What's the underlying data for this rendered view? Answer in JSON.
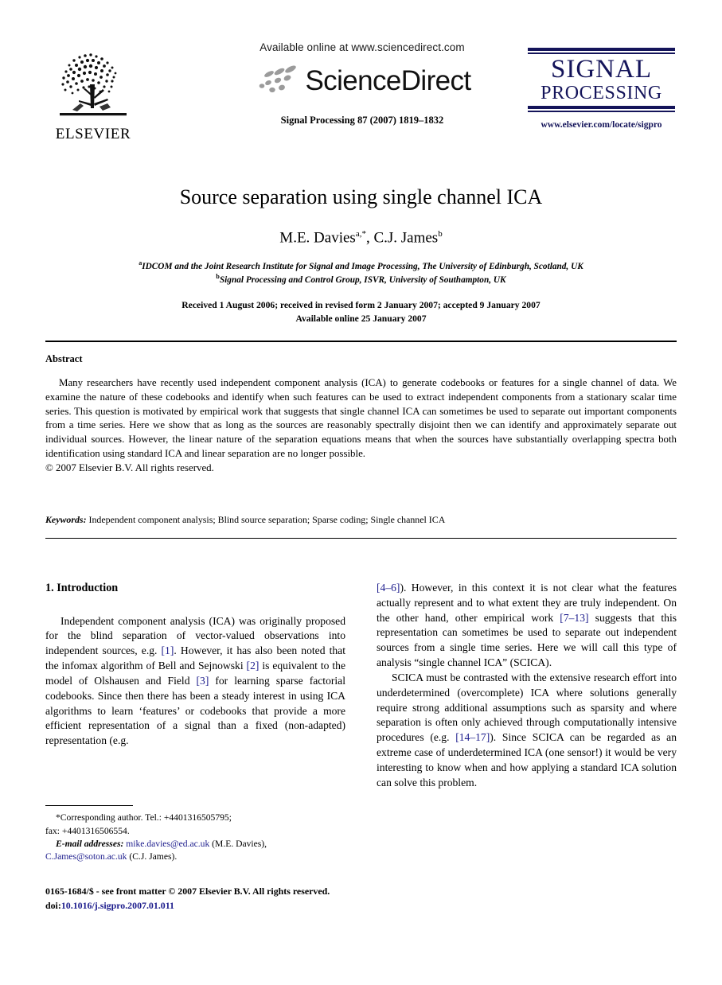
{
  "masthead": {
    "publisher_name": "ELSEVIER",
    "available_online": "Available online at www.sciencedirect.com",
    "sciencedirect_word": "ScienceDirect",
    "journal_ref": "Signal Processing 87 (2007) 1819–1832",
    "journal_logo_line1": "SIGNAL",
    "journal_logo_line2": "PROCESSING",
    "journal_url": "www.elsevier.com/locate/sigpro"
  },
  "title_block": {
    "title": "Source separation using single channel ICA",
    "authors_text": "M.E. Davies",
    "author1_sup": "a,*",
    "authors_text2": ", C.J. James",
    "author2_sup": "b",
    "affiliation_a_sup": "a",
    "affiliation_a": "IDCOM and the Joint Research Institute for Signal and Image Processing, The University of Edinburgh, Scotland, UK",
    "affiliation_b_sup": "b",
    "affiliation_b": "Signal Processing and Control Group, ISVR, University of Southampton, UK",
    "received": "Received 1 August 2006; received in revised form 2 January 2007; accepted 9 January 2007",
    "available": "Available online 25 January 2007"
  },
  "abstract": {
    "heading": "Abstract",
    "body": "Many researchers have recently used independent component analysis (ICA) to generate codebooks or features for a single channel of data. We examine the nature of these codebooks and identify when such features can be used to extract independent components from a stationary scalar time series. This question is motivated by empirical work that suggests that single channel ICA can sometimes be used to separate out important components from a time series. Here we show that as long as the sources are reasonably spectrally disjoint then we can identify and approximately separate out individual sources. However, the linear nature of the separation equations means that when the sources have substantially overlapping spectra both identification using standard ICA and linear separation are no longer possible.",
    "copyright": "© 2007 Elsevier B.V. All rights reserved.",
    "keywords_label": "Keywords:",
    "keywords_value": " Independent component analysis; Blind source separation; Sparse coding; Single channel ICA"
  },
  "body": {
    "section_heading": "1.  Introduction",
    "left_p1_a": "Independent component analysis (ICA) was originally proposed for the blind separation of vector-valued observations into independent sources, e.g. ",
    "left_p1_ref1": "[1]",
    "left_p1_b": ". However, it has also been noted that the infomax algorithm of Bell and Sejnowski ",
    "left_p1_ref2": "[2]",
    "left_p1_c": " is equivalent to the model of Olshausen and Field ",
    "left_p1_ref3": "[3]",
    "left_p1_d": " for learning sparse factorial codebooks. Since then there has been a steady interest in using ICA algorithms to learn ‘features’ or codebooks that provide a more efficient representation of a signal than a fixed (non-adapted) representation (e.g.",
    "right_p1_ref": "[4–6]",
    "right_p1_a": "). However, in this context it is not clear what the features actually represent and to what extent they are truly independent. On the other hand, other empirical work ",
    "right_p1_ref2": "[7–13]",
    "right_p1_b": " suggests that this representation can sometimes be used to separate out independent sources from a single time series. Here we will call this type of analysis “single channel ICA” (SCICA).",
    "right_p2_a": "SCICA must be contrasted with the extensive research effort into underdetermined (overcomplete) ICA where solutions generally require strong additional assumptions such as sparsity and where separation is often only achieved through computationally intensive procedures (e.g. ",
    "right_p2_ref": "[14–17]",
    "right_p2_b": "). Since SCICA can be regarded as an extreme case of underdetermined ICA (one sensor!) it would be very interesting to know when and how applying a standard ICA solution can solve this problem."
  },
  "footnote": {
    "corresponding": "*Corresponding author. Tel.: +4401316505795;",
    "fax": "fax: +4401316506554.",
    "email_label": "E-mail addresses:",
    "email1": "mike.davies@ed.ac.uk",
    "email1_name": " (M.E. Davies),",
    "email2": "C.James@soton.ac.uk",
    "email2_name": " (C.J. James)."
  },
  "footer": {
    "issn_line": "0165-1684/$ - see front matter © 2007 Elsevier B.V. All rights reserved.",
    "doi_label": "doi:",
    "doi_value": "10.1016/j.sigpro.2007.01.011"
  },
  "colors": {
    "link": "#1c1c8c",
    "journal_navy": "#14145a",
    "text": "#000000",
    "background": "#ffffff"
  }
}
